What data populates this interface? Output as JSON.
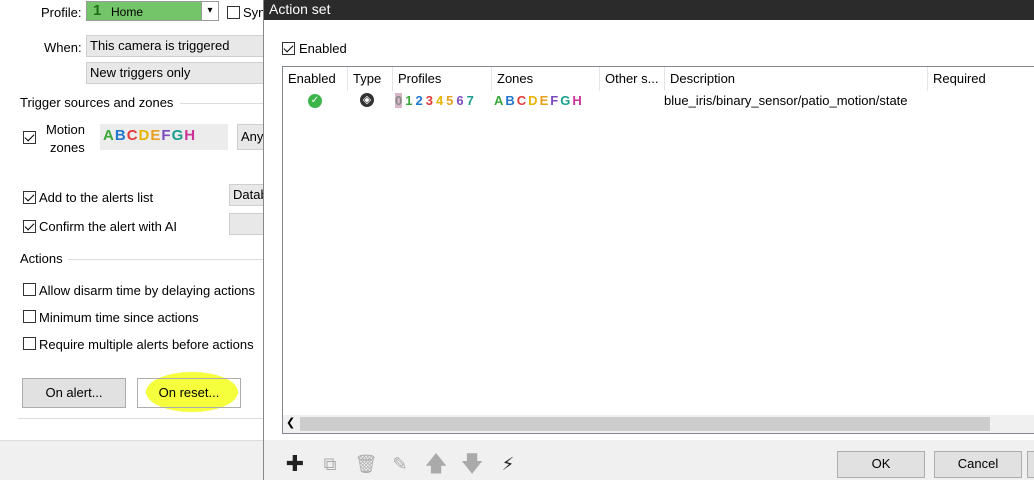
{
  "settings": {
    "profile_label": "Profile:",
    "profile_value": "Home",
    "profile_number": "1",
    "sync_label": "Syn",
    "when_label": "When:",
    "when_value": "This camera is triggered",
    "when_value2": "New triggers only",
    "trigger_group": "Trigger sources and zones",
    "motion_label_1": "Motion",
    "motion_label_2": "zones",
    "zones": [
      "A",
      "B",
      "C",
      "D",
      "E",
      "F",
      "G",
      "H"
    ],
    "zone_colors": [
      "#3aa83a",
      "#2277cc",
      "#e23b3b",
      "#e8b400",
      "#e8a020",
      "#7b4cc0",
      "#1a9e8e",
      "#cc3399"
    ],
    "any_label": "Any",
    "add_alerts_label": "Add to the alerts list",
    "database_label": "Datab",
    "confirm_ai_label": "Confirm the alert with AI",
    "actions_group": "Actions",
    "allow_disarm_label": "Allow disarm time by delaying actions",
    "min_time_label": "Minimum time since actions",
    "require_multi_label": "Require multiple alerts before actions",
    "on_alert_button": "On alert...",
    "on_reset_button": "On reset..."
  },
  "dialog": {
    "title": "Action set",
    "enabled_label": "Enabled",
    "columns": {
      "enabled": "Enabled",
      "type": "Type",
      "profiles": "Profiles",
      "zones": "Zones",
      "other": "Other s...",
      "description": "Description",
      "required": "Required"
    },
    "row": {
      "profiles": [
        "0",
        "1",
        "2",
        "3",
        "4",
        "5",
        "6",
        "7"
      ],
      "profile_colors": [
        "#888888",
        "#3aa83a",
        "#2277cc",
        "#e23b3b",
        "#e8b400",
        "#e8a020",
        "#7b4cc0",
        "#1a9e8e"
      ],
      "zones": [
        "A",
        "B",
        "C",
        "D",
        "E",
        "F",
        "G",
        "H"
      ],
      "description": "blue_iris/binary_sensor/patio_motion/state"
    },
    "ok_button": "OK",
    "cancel_button": "Cancel"
  }
}
